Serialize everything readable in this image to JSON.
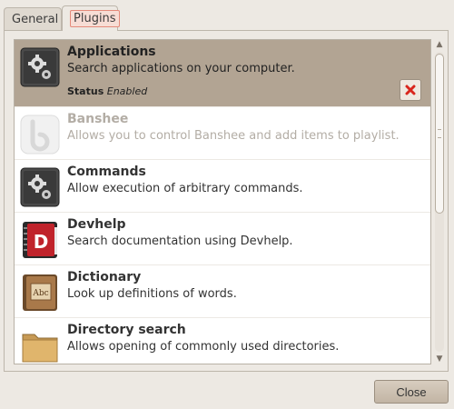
{
  "tabs": [
    {
      "label": "General",
      "active": false
    },
    {
      "label": "Plugins",
      "active": true
    }
  ],
  "plugins": [
    {
      "name": "Applications",
      "description": "Search applications on your computer.",
      "status_label": "Status",
      "status_value": "Enabled",
      "icon": "gears-icon",
      "selected": true
    },
    {
      "name": "Banshee",
      "description": "Allows you to control Banshee and add items to playlist.",
      "icon": "banshee-icon",
      "disabled": true
    },
    {
      "name": "Commands",
      "description": "Allow execution of arbitrary commands.",
      "icon": "gears-icon"
    },
    {
      "name": "Devhelp",
      "description": "Search documentation using Devhelp.",
      "icon": "devhelp-book-icon"
    },
    {
      "name": "Dictionary",
      "description": "Look up definitions of words.",
      "icon": "dictionary-book-icon",
      "icon_text": "Abc"
    },
    {
      "name": "Directory search",
      "description": "Allows opening of commonly used directories.",
      "icon": "folder-icon"
    }
  ],
  "buttons": {
    "close": "Close"
  },
  "colors": {
    "selected_row": "#b2a493",
    "remove": "#d9261c"
  }
}
